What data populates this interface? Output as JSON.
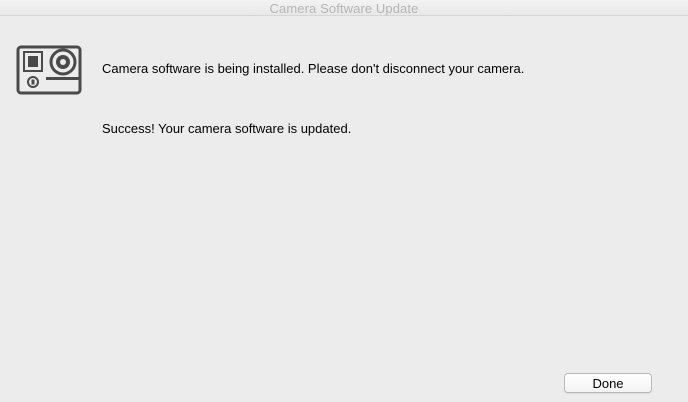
{
  "window": {
    "title": "Camera Software Update"
  },
  "icon": {
    "name": "camera-icon"
  },
  "messages": {
    "installing": "Camera software is being installed. Please don't disconnect your camera.",
    "success": "Success! Your camera software is updated."
  },
  "buttons": {
    "done_label": "Done"
  },
  "colors": {
    "window_background": "#ececec",
    "title_text": "#b4b4b4",
    "icon": "#4a4a4a"
  }
}
